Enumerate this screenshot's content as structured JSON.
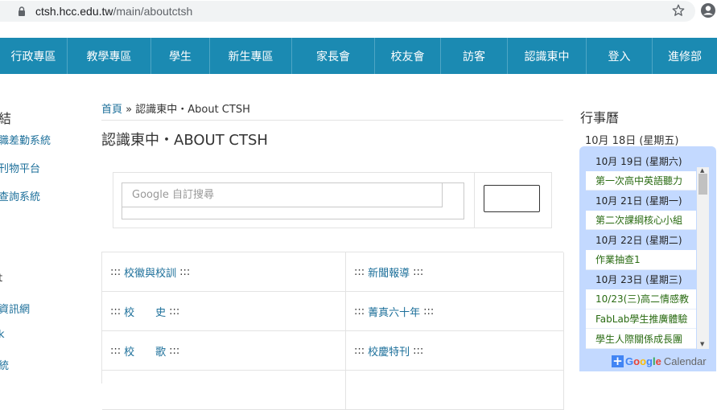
{
  "browser": {
    "url_host": "ctsh.hcc.edu.tw",
    "url_path": "/main/aboutctsh"
  },
  "nav": {
    "items": [
      "行政專區",
      "教學專區",
      "學生",
      "新生專區",
      "家長會",
      "校友會",
      "訪客",
      "認識東中",
      "登入",
      "進修部"
    ]
  },
  "sidebar": {
    "title": "結",
    "links": [
      "職差勤系統",
      "刊物平台",
      "查詢系統",
      "t",
      "資訊網",
      "k",
      "統"
    ]
  },
  "breadcrumb": {
    "home": "首頁",
    "sep": " » ",
    "current": "認識東中・About CTSH"
  },
  "page": {
    "title": "認識東中・ABOUT CTSH"
  },
  "search": {
    "placeholder": "Google 自訂搜尋"
  },
  "links": [
    {
      "prefix": ":::",
      "label": "校徽與校訓",
      "suffix": ":::"
    },
    {
      "prefix": ":::",
      "label": "新聞報導",
      "suffix": ":::"
    },
    {
      "prefix": ":::",
      "label": "校　　史",
      "suffix": ":::"
    },
    {
      "prefix": ":::",
      "label": "菁真六十年",
      "suffix": ":::"
    },
    {
      "prefix": ":::",
      "label": "校　　歌",
      "suffix": ":::"
    },
    {
      "prefix": ":::",
      "label": "校慶特刊",
      "suffix": ":::"
    }
  ],
  "calendar": {
    "title": "行事曆",
    "today": "10月 18日 (星期五)",
    "entries": [
      {
        "type": "date",
        "text": "10月 19日 (星期六)"
      },
      {
        "type": "event",
        "text": "第一次高中英語聽力"
      },
      {
        "type": "date",
        "text": "10月 21日 (星期一)"
      },
      {
        "type": "event",
        "text": "第二次課綱核心小組"
      },
      {
        "type": "date",
        "text": "10月 22日 (星期二)"
      },
      {
        "type": "event",
        "text": "作業抽查1"
      },
      {
        "type": "date",
        "text": "10月 23日 (星期三)"
      },
      {
        "type": "event",
        "text": "10/23(三)高二情感教"
      },
      {
        "type": "event",
        "text": "FabLab學生推廣體驗"
      },
      {
        "type": "event",
        "text": "學生人際關係成長團"
      }
    ],
    "footer_google": "Google",
    "footer_calendar": "Calendar",
    "google_colors": [
      "#4285f4",
      "#ea4335",
      "#fbbc05",
      "#4285f4",
      "#34a853",
      "#ea4335"
    ]
  },
  "colors": {
    "nav_bg": "#1b8ab2",
    "link": "#1c6f9a",
    "calendar_bg": "#c3d9ff",
    "event_text": "#2a6b12"
  }
}
